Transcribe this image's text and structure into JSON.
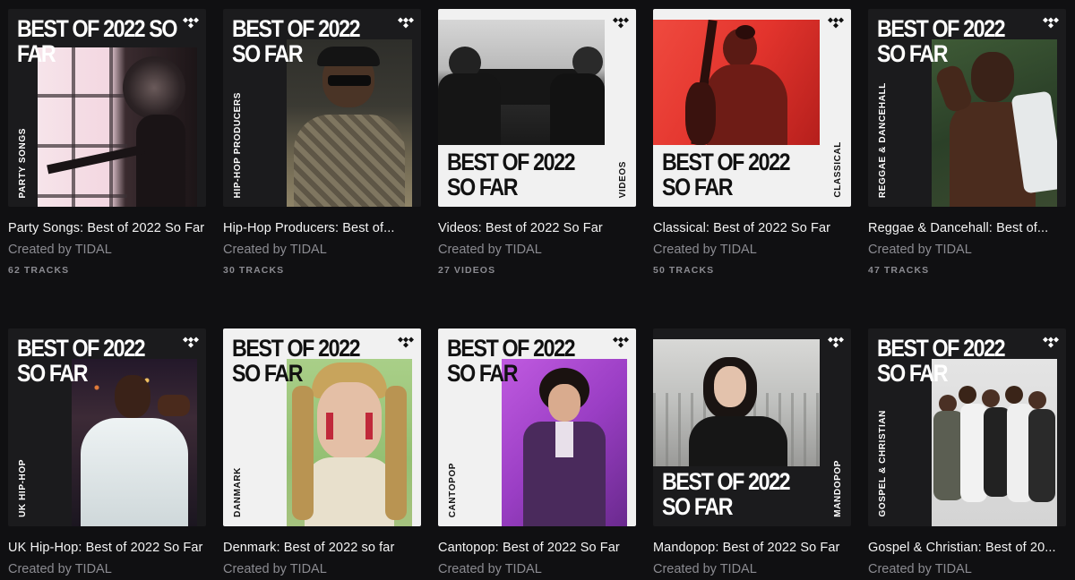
{
  "playlists": [
    {
      "id": "party",
      "headline": "BEST OF 2022 SO FAR",
      "genre_label": "PARTY SONGS",
      "title": "Party Songs: Best of 2022 So Far",
      "creator": "Created by TIDAL",
      "count": "62 TRACKS",
      "theme": "dark",
      "photo_colors": [
        "#f2d9e0",
        "#2a2022"
      ]
    },
    {
      "id": "hiphop-producers",
      "headline": "BEST OF 2022\nSO FAR",
      "genre_label": "HIP-HOP PRODUCERS",
      "title": "Hip-Hop Producers: Best of...",
      "creator": "Created by TIDAL",
      "count": "30 TRACKS",
      "theme": "dark",
      "photo_colors": [
        "#3a3a34",
        "#8a7f68"
      ]
    },
    {
      "id": "videos",
      "headline": "BEST OF 2022\nSO FAR",
      "genre_label": "VIDEOS",
      "title": "Videos: Best of 2022 So Far",
      "creator": "Created by TIDAL",
      "count": "27 VIDEOS",
      "theme": "light",
      "photo_colors": [
        "#d0d0d0",
        "#1a1a1a"
      ]
    },
    {
      "id": "classical",
      "headline": "BEST OF 2022\nSO FAR",
      "genre_label": "CLASSICAL",
      "title": "Classical: Best of 2022 So Far",
      "creator": "Created by TIDAL",
      "count": "50 TRACKS",
      "theme": "light",
      "photo_colors": [
        "#e8352f",
        "#7a1412"
      ]
    },
    {
      "id": "reggae",
      "headline": "BEST OF 2022\nSO FAR",
      "genre_label": "REGGAE & DANCEHALL",
      "title": "Reggae & Dancehall: Best of...",
      "creator": "Created by TIDAL",
      "count": "47 TRACKS",
      "theme": "dark",
      "photo_colors": [
        "#2f4a2c",
        "#5b3a2a"
      ]
    },
    {
      "id": "uk-hiphop",
      "headline": "BEST OF 2022\nSO FAR",
      "genre_label": "UK HIP-HOP",
      "title": "UK Hip-Hop: Best of 2022 So Far",
      "creator": "Created by TIDAL",
      "count": "",
      "theme": "dark",
      "photo_colors": [
        "#2a1e2e",
        "#e8eef0"
      ]
    },
    {
      "id": "danmark",
      "headline": "BEST OF 2022\nSO FAR",
      "genre_label": "DANMARK",
      "title": "Denmark: Best of 2022 so far",
      "creator": "Created by TIDAL",
      "count": "",
      "theme": "light",
      "photo_colors": [
        "#9dc27e",
        "#c9a766"
      ]
    },
    {
      "id": "cantopop",
      "headline": "BEST OF 2022\nSO FAR",
      "genre_label": "CANTOPOP",
      "title": "Cantopop: Best of 2022 So Far",
      "creator": "Created by TIDAL",
      "count": "",
      "theme": "light",
      "photo_colors": [
        "#a24ad0",
        "#3a1f4e"
      ]
    },
    {
      "id": "mandopop",
      "headline": "BEST OF 2022\nSO FAR",
      "genre_label": "MANDOPOP",
      "title": "Mandopop: Best of 2022 So Far",
      "creator": "Created by TIDAL",
      "count": "",
      "theme": "dark",
      "photo_colors": [
        "#c8c9c8",
        "#241a16"
      ]
    },
    {
      "id": "gospel",
      "headline": "BEST OF 2022\nSO FAR",
      "genre_label": "GOSPEL & CHRISTIAN",
      "title": "Gospel & Christian: Best of 20...",
      "creator": "Created by TIDAL",
      "count": "",
      "theme": "dark",
      "photo_colors": [
        "#d9d9d9",
        "#3d3d3d"
      ]
    }
  ],
  "icons": {
    "brand": "tidal-logo-icon"
  }
}
